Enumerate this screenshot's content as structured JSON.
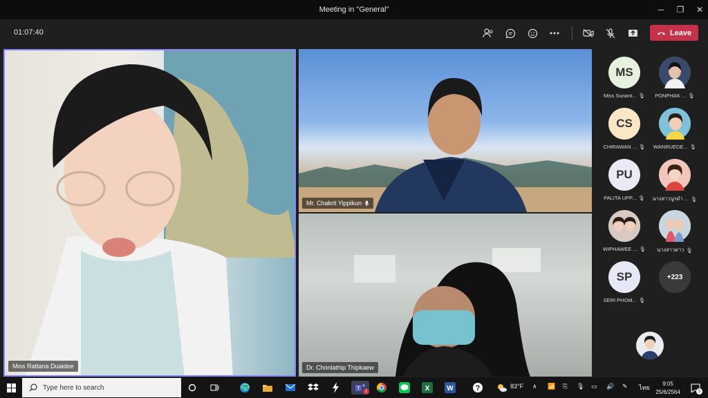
{
  "window": {
    "title": "Meeting in \"General\"",
    "minimize": "─",
    "restore": "❐",
    "close": "✕"
  },
  "toolbar": {
    "timer": "01:07:40",
    "leave_label": "Leave"
  },
  "tiles": [
    {
      "name": "Miss Rattana Duaidee"
    },
    {
      "name": "Mr. Chakrit Yippikun"
    },
    {
      "name": "Dr. Chonlathip Thipkaew"
    }
  ],
  "roster": [
    {
      "initials": "MS",
      "name": "Miss Sunant...",
      "color": "#e7f2de"
    },
    {
      "initials": "",
      "name": "PONPHAK ...",
      "color": "#3b4a6b"
    },
    {
      "initials": "CS",
      "name": "CHIRAWAN ...",
      "color": "#fbe6c6"
    },
    {
      "initials": "",
      "name": "WANRUEDE...",
      "color": "#7fc1d8"
    },
    {
      "initials": "PU",
      "name": "PALITA UPP...",
      "color": "#ece8f6"
    },
    {
      "initials": "",
      "name": "นางสาวนูรดำ ...",
      "color": "#e9a9a0"
    },
    {
      "initials": "",
      "name": "WIPHAWEE ...",
      "color": "#c9b3a8"
    },
    {
      "initials": "",
      "name": "นางสาวดาว",
      "color": "#b7c7d6"
    },
    {
      "initials": "SP",
      "name": "SERI PHOM...",
      "color": "#e6e8f5"
    },
    {
      "initials": "+223",
      "name": "",
      "color": "#3a3a3a"
    }
  ],
  "taskbar": {
    "search_placeholder": "Type here to search",
    "weather": "83°F",
    "lang": "ไทย",
    "time": "9:05",
    "date": "25/6/2564",
    "teams_badge": "2",
    "notif_badge": "3"
  },
  "colors": {
    "accent": "#8a88ff",
    "leave": "#c4314b"
  }
}
